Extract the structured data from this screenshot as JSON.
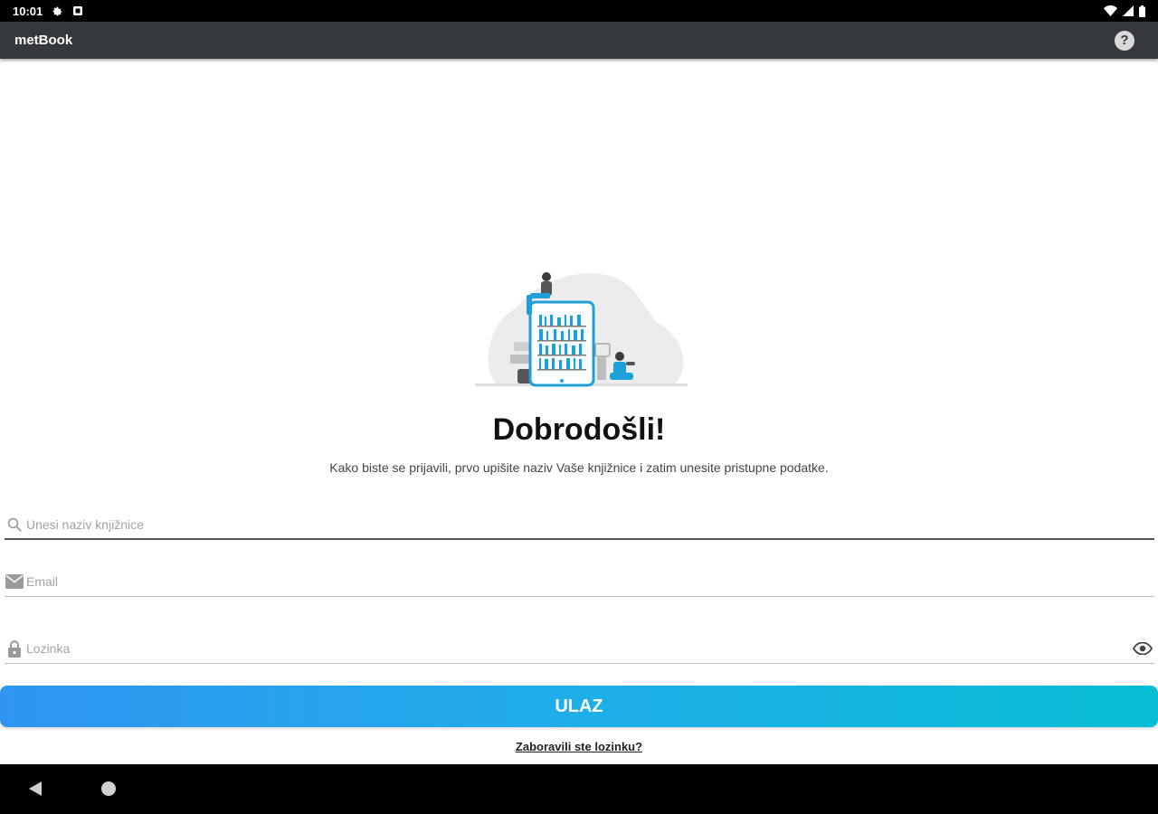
{
  "status_bar": {
    "time": "10:01",
    "left_icons": [
      "gear-icon",
      "notification-square-icon"
    ],
    "right_icons": [
      "wifi-icon",
      "signal-icon",
      "battery-icon"
    ]
  },
  "app_bar": {
    "title": "metBook",
    "help_label": "?"
  },
  "welcome": {
    "title": "Dobrodošli!",
    "subtitle": "Kako biste se prijavili, prvo upišite naziv Vaše knjižnice i zatim unesite pristupne podatke."
  },
  "form": {
    "library": {
      "value": "",
      "placeholder": "Unesi naziv knjižnice",
      "icon": "search-icon"
    },
    "email": {
      "value": "",
      "placeholder": "Email",
      "icon": "mail-icon"
    },
    "password": {
      "value": "",
      "placeholder": "Lozinka",
      "icon": "lock-icon",
      "toggle_icon": "eye-icon"
    },
    "submit_label": "ULAZ",
    "forgot_label": "Zaboravili ste lozinku?"
  },
  "colors": {
    "app_bar": "#35383d",
    "button_start": "#2f95f3",
    "button_end": "#08bdd3",
    "accent_illustration": "#1e9fd8"
  },
  "nav_bar": {
    "icons": [
      "back-icon",
      "home-icon"
    ]
  }
}
